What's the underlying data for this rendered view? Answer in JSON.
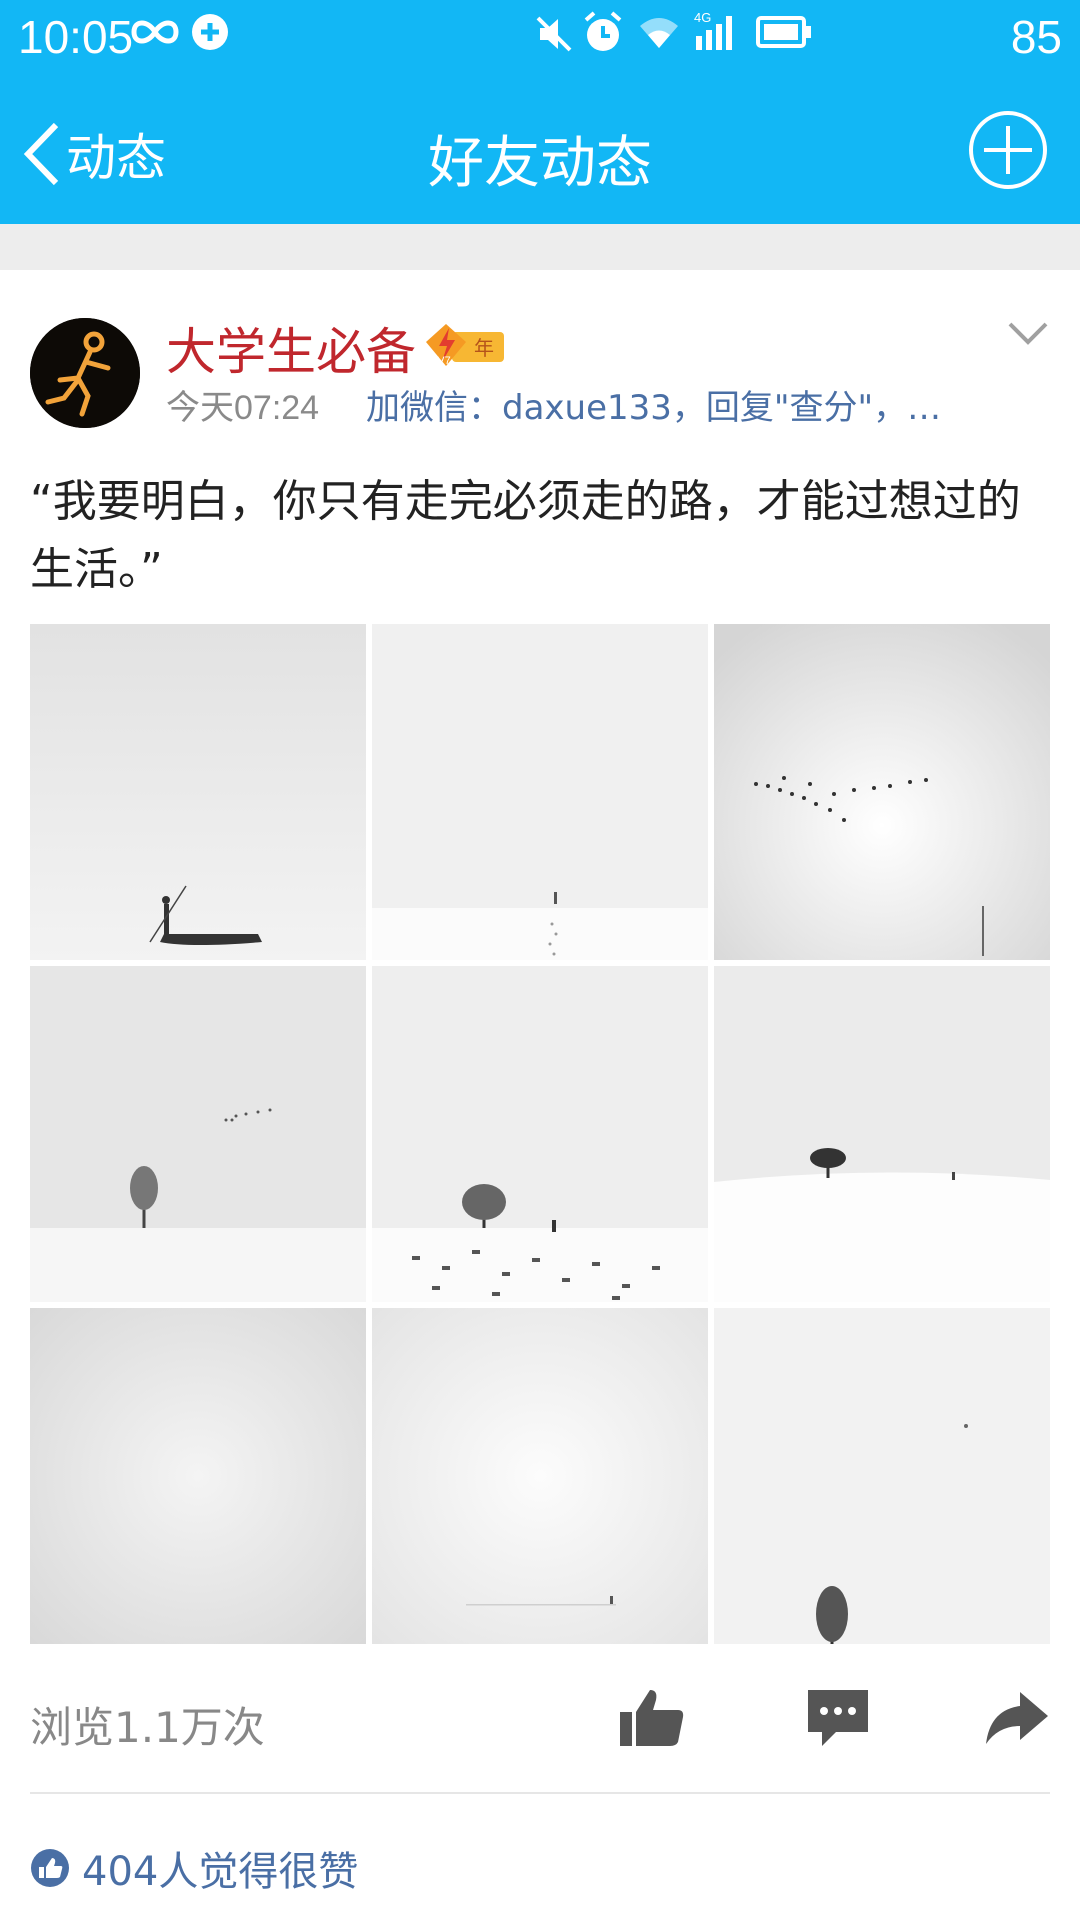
{
  "status_bar": {
    "time": "10:05",
    "battery": "85",
    "icons": [
      "infinity-icon",
      "qq-sync-icon",
      "mute-icon",
      "alarm-icon",
      "wifi-icon",
      "4g-signal-icon",
      "battery-icon"
    ],
    "network_label": "4G"
  },
  "title_bar": {
    "back_label": "动态",
    "title": "好友动态",
    "add_icon": "plus-circle-icon"
  },
  "post": {
    "author": "大学生必备",
    "badge_level": "LV7",
    "badge_year": "年",
    "time": "今天07:24",
    "source": "加微信：daxue133，回复\"查分\"，…",
    "text": "“我要明白，你只有走完必须走的路，才能过想过的生活。”",
    "images": [
      "snow-boat-fisherman",
      "snow-lone-walker",
      "flock-of-birds",
      "tree-and-birds",
      "tree-walker-footprints",
      "tree-on-hill",
      "foggy-blank",
      "distant-figure",
      "bare-tree-bottom"
    ]
  },
  "actions": {
    "views": "浏览1.1万次",
    "like_icon": "thumbs-up-icon",
    "comment_icon": "comment-icon",
    "share_icon": "share-icon"
  },
  "likes": {
    "text": "404人觉得很赞"
  },
  "colors": {
    "header_blue": "#12b7f5",
    "author_red": "#c0272d",
    "link_blue": "#4a6fa5"
  }
}
